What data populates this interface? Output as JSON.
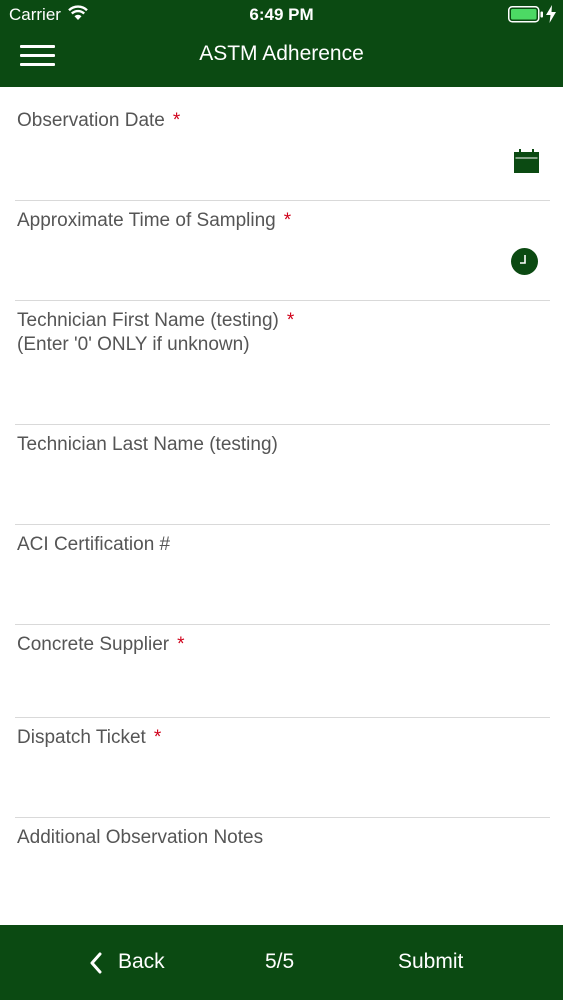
{
  "status_bar": {
    "carrier": "Carrier",
    "time": "6:49 PM",
    "icons": [
      "wifi-icon",
      "battery-icon",
      "charging-bolt-icon"
    ]
  },
  "header": {
    "title": "ASTM Adherence",
    "menu_icon": "hamburger-menu-icon"
  },
  "form": {
    "fields": [
      {
        "label": "Observation Date",
        "required": "*",
        "icon": "calendar-icon"
      },
      {
        "label": "Approximate Time of Sampling",
        "required": "*",
        "icon": "clock-icon"
      },
      {
        "label": "Technician First Name (testing)",
        "required": "*",
        "hint": " (Enter '0' ONLY if unknown)"
      },
      {
        "label": "Technician Last Name (testing)"
      },
      {
        "label": "ACI Certification #"
      },
      {
        "label": "Concrete Supplier",
        "required": "*"
      },
      {
        "label": "Dispatch Ticket",
        "required": "*"
      },
      {
        "label": "Additional Observation Notes"
      }
    ]
  },
  "footer": {
    "back_label": "Back",
    "page_indicator": "5/5",
    "submit_label": "Submit"
  },
  "colors": {
    "brand_green": "#0b4a12",
    "required_red": "#d0021b",
    "battery_green": "#4cd964"
  }
}
